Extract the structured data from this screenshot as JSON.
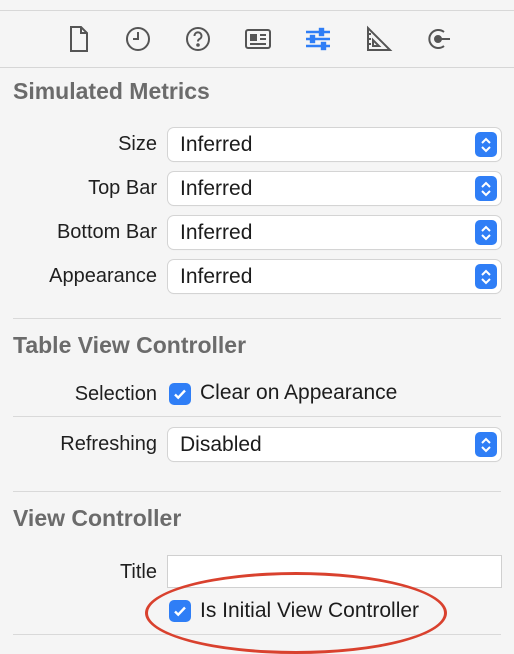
{
  "toolbar": {
    "icons": [
      "file-icon",
      "clock-icon",
      "help-icon",
      "identity-card-icon",
      "sliders-icon",
      "ruler-icon",
      "connections-icon"
    ],
    "active": "sliders-icon",
    "accent_color": "#2f7ef6"
  },
  "simulated_metrics": {
    "title": "Simulated Metrics",
    "rows": [
      {
        "label": "Size",
        "value": "Inferred"
      },
      {
        "label": "Top Bar",
        "value": "Inferred"
      },
      {
        "label": "Bottom Bar",
        "value": "Inferred"
      },
      {
        "label": "Appearance",
        "value": "Inferred"
      }
    ]
  },
  "table_view_controller": {
    "title": "Table View Controller",
    "selection_label": "Selection",
    "selection_checkbox_label": "Clear on Appearance",
    "selection_checked": true,
    "refreshing_label": "Refreshing",
    "refreshing_value": "Disabled"
  },
  "view_controller": {
    "title": "View Controller",
    "title_label": "Title",
    "title_value": "",
    "initial_checkbox_label": "Is Initial View Controller",
    "initial_checked": true
  },
  "annotation_color": "#d9412e"
}
